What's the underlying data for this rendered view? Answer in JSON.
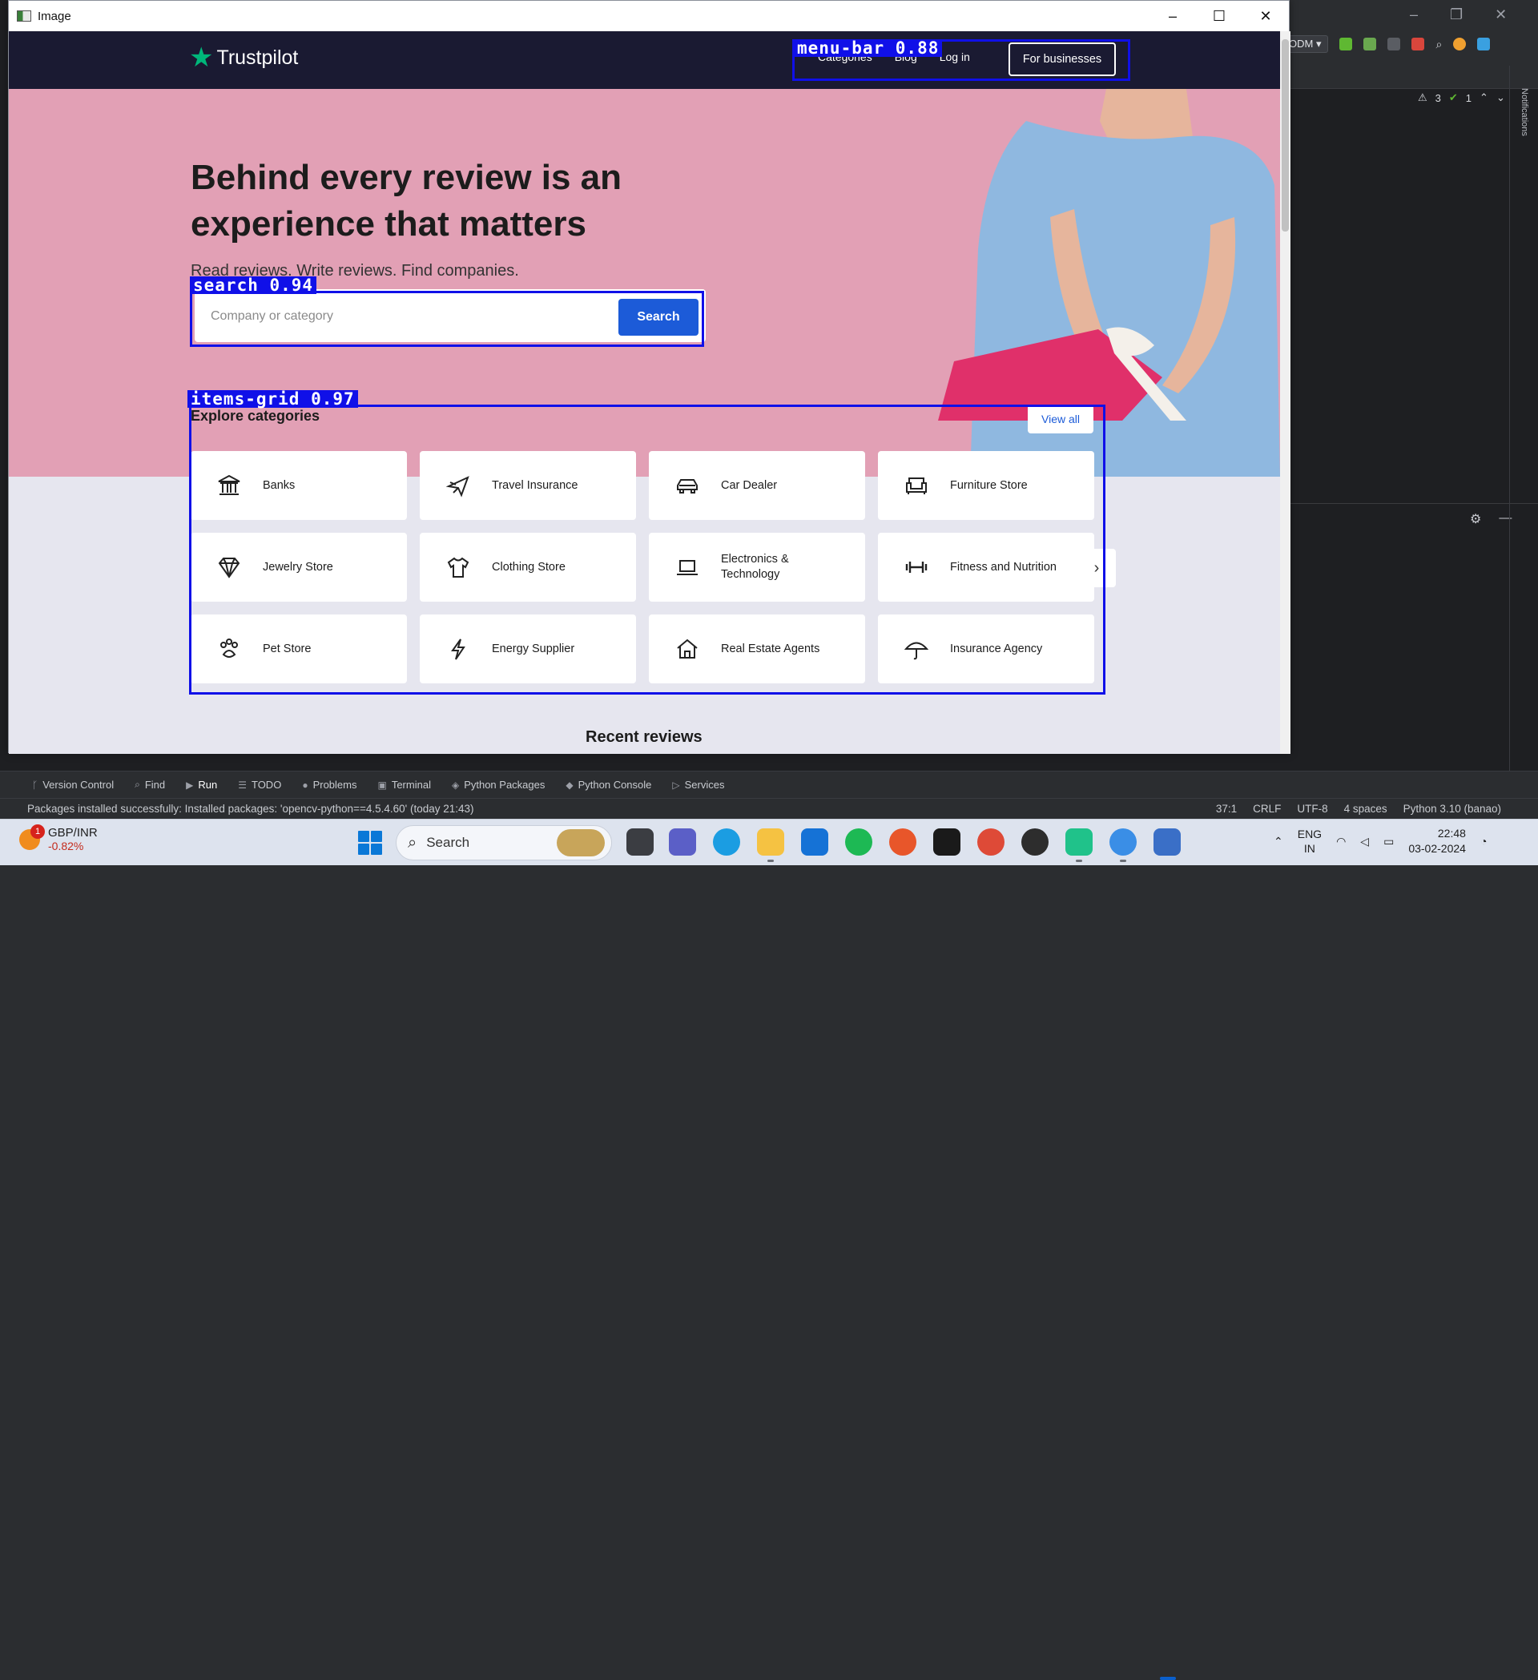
{
  "window": {
    "title": "Image"
  },
  "site": {
    "brand": "Trustpilot",
    "nav": {
      "categories": "Categories",
      "blog": "Blog",
      "login": "Log in",
      "businesses": "For businesses"
    },
    "hero": {
      "title": "Behind every review is an experience that matters",
      "subtitle": "Read reviews. Write reviews. Find companies.",
      "search_placeholder": "Company or category",
      "search_button": "Search"
    },
    "categories": {
      "heading": "Explore categories",
      "view_all": "View all",
      "items": [
        {
          "label": "Banks",
          "icon": "bank-icon"
        },
        {
          "label": "Travel Insurance",
          "icon": "airplane-icon"
        },
        {
          "label": "Car Dealer",
          "icon": "car-icon"
        },
        {
          "label": "Furniture Store",
          "icon": "armchair-icon"
        },
        {
          "label": "Jewelry Store",
          "icon": "diamond-icon"
        },
        {
          "label": "Clothing Store",
          "icon": "shirt-icon"
        },
        {
          "label": "Electronics & Technology",
          "icon": "laptop-icon"
        },
        {
          "label": "Fitness and Nutrition",
          "icon": "dumbbell-icon"
        },
        {
          "label": "Pet Store",
          "icon": "paw-icon"
        },
        {
          "label": "Energy Supplier",
          "icon": "lightning-icon"
        },
        {
          "label": "Real Estate Agents",
          "icon": "house-icon"
        },
        {
          "label": "Insurance Agency",
          "icon": "umbrella-icon"
        }
      ]
    },
    "recent_heading": "Recent reviews"
  },
  "detections": [
    {
      "label": "menu-bar 0.88"
    },
    {
      "label": "search 0.94"
    },
    {
      "label": "items-grid 0.97"
    }
  ],
  "ide": {
    "run_config": "ODM",
    "warnings": "3",
    "checks": "1",
    "notifications_label": "Notifications",
    "toolwindows": [
      "Version Control",
      "Find",
      "Run",
      "TODO",
      "Problems",
      "Terminal",
      "Python Packages",
      "Python Console",
      "Services"
    ],
    "status_message": "Packages installed successfully: Installed packages: 'opencv-python==4.5.4.60' (today 21:43)",
    "status_right": [
      "37:1",
      "CRLF",
      "UTF-8",
      "4 spaces",
      "Python 3.10 (banao)"
    ]
  },
  "taskbar": {
    "widget_title": "GBP/INR",
    "widget_value": "-0.82%",
    "widget_badge": "1",
    "search_label": "Search",
    "lang_top": "ENG",
    "lang_bottom": "IN",
    "time": "22:48",
    "date": "03-02-2024"
  },
  "colors": {
    "brand_green": "#00b67a",
    "accent_blue": "#1c5bd8",
    "navbar": "#1a1a32",
    "hero_pink": "#e2a0b5",
    "detection_blue": "#1010e8"
  }
}
